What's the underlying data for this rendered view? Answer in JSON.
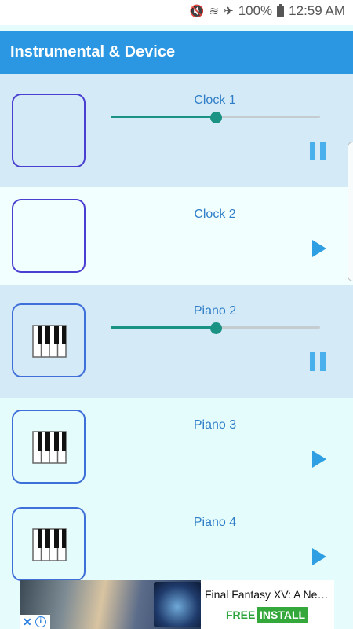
{
  "status_bar": {
    "battery": "100%",
    "time": "12:59 AM",
    "icons": [
      "mute-vibrate-icon",
      "wifi-icon",
      "airplane-icon",
      "battery-icon"
    ]
  },
  "app_bar": {
    "title": "Instrumental & Device"
  },
  "sounds": [
    {
      "name": "Clock 1",
      "icon": "waveform-icon",
      "state": "playing",
      "progress": 0.5
    },
    {
      "name": "Clock 2",
      "icon": "waveform-icon",
      "state": "stopped"
    },
    {
      "name": "Piano 2",
      "icon": "piano-keys-icon",
      "state": "playing",
      "progress": 0.5
    },
    {
      "name": "Piano 3",
      "icon": "piano-keys-icon",
      "state": "stopped"
    },
    {
      "name": "Piano 4",
      "icon": "piano-keys-icon",
      "state": "stopped"
    }
  ],
  "ad": {
    "title": "Final Fantasy XV: A Ne…",
    "free_label": "FREE",
    "install_label": "INSTALL",
    "close_icon": "close-icon",
    "info_icon": "info-icon",
    "info_glyph": "i"
  },
  "colors": {
    "app_bar": "#2b97e3",
    "playing_row": "#d4eaf7",
    "accent_teal": "#1a9384",
    "play_icon": "#2e9fe3"
  }
}
